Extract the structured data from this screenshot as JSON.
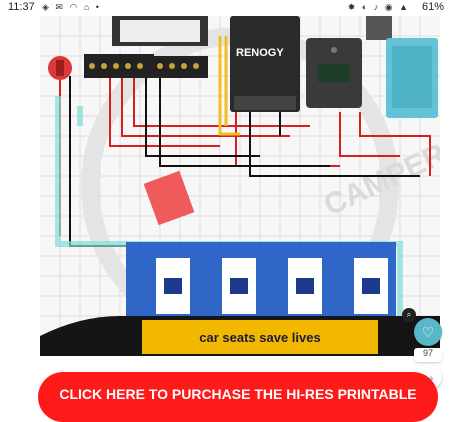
{
  "status": {
    "time": "11:37",
    "battery": "61%"
  },
  "diagram": {
    "renogy_label": "RENOGY",
    "roof_gland_label": "ROOF ENTRY GLAND",
    "sticker_text": "car seats save lives",
    "watermark": "CAMPERS"
  },
  "actions": {
    "like_count": "97",
    "cta_label": "CLICK HERE TO PURCHASE THE HI-RES PRINTABLE"
  },
  "colors": {
    "cta": "#ff1a1a",
    "sticker": "#f2b800",
    "accent": "#5ab6c9",
    "battery": "#2f66c8"
  }
}
